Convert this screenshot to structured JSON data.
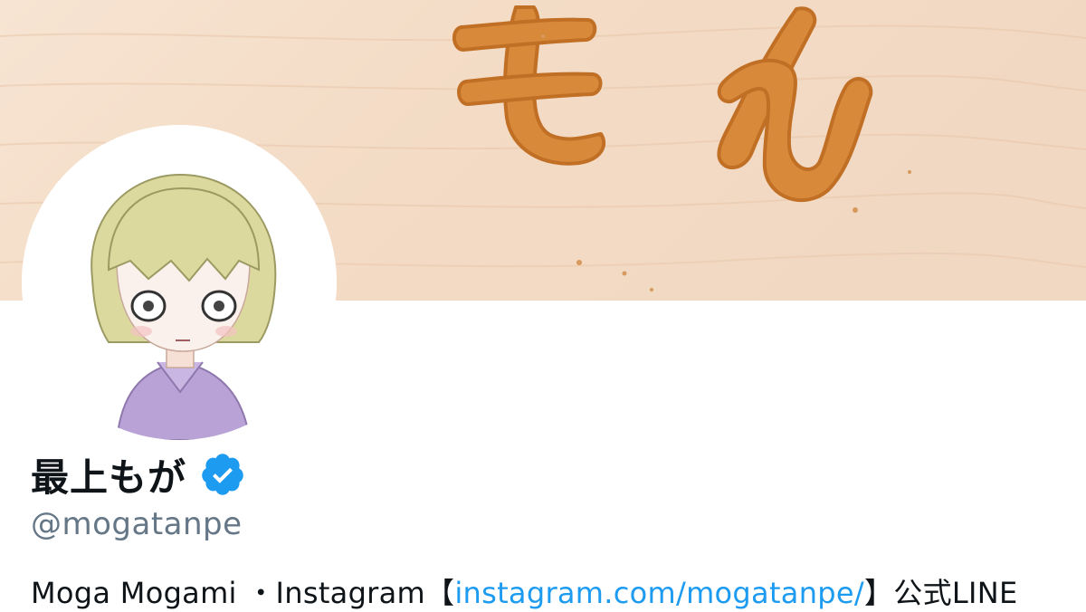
{
  "profile": {
    "display_name": "最上もが",
    "verified": true,
    "verified_icon": "verified-badge-icon",
    "handle": "@mogatanpe",
    "bio": {
      "prefix": "Moga Mogami ・Instagram【",
      "link_text": "instagram.com/mogatanpe/",
      "suffix": "】公式LINE"
    }
  },
  "colors": {
    "link": "#1d9bf0",
    "verified": "#1d9bf0",
    "handle": "#657786",
    "name": "#0f1419"
  }
}
